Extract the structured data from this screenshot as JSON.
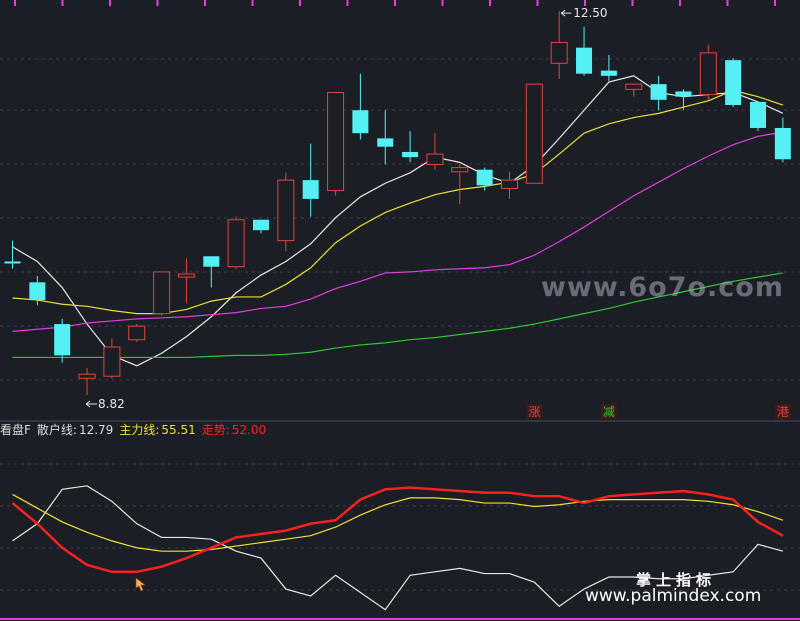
{
  "colors": {
    "bg": "#1c1e26",
    "up": "#e0443c",
    "down": "#54f0f4",
    "ma_white": "#e8e8e8",
    "ma_yellow": "#e8e035",
    "ma_magenta": "#e13ce1",
    "ma_green": "#2ec436",
    "retail": "#e8e8e8",
    "main_force": "#f0e033",
    "trend": "#ff2020",
    "label_up": "#e0443c",
    "label_down": "#31c831",
    "pink_ticks": "#e040e0"
  },
  "legend": {
    "indicator": "看盘F",
    "retail_label": "散户线:",
    "retail_value": "12.79",
    "main_label": "主力线:",
    "main_value": "55.51",
    "trend_label": "走势:",
    "trend_value": "52.00"
  },
  "annotations": {
    "high_label": "12.50",
    "low_label": "8.82"
  },
  "watermarks": {
    "site": "www.6o7o.com",
    "cn": "掌上指标",
    "url": "www.palmindex.com"
  },
  "chart_data": [
    {
      "type": "candlestick",
      "title": "",
      "candles": [
        {
          "o": 10.1,
          "h": 10.3,
          "l": 10.03,
          "c": 10.1,
          "dir": "down"
        },
        {
          "o": 9.9,
          "h": 9.96,
          "l": 9.68,
          "c": 9.73,
          "dir": "down"
        },
        {
          "o": 9.5,
          "h": 9.55,
          "l": 9.13,
          "c": 9.2,
          "dir": "down"
        },
        {
          "o": 8.98,
          "h": 9.08,
          "l": 8.82,
          "c": 9.02,
          "dir": "up"
        },
        {
          "o": 9.0,
          "h": 9.36,
          "l": 8.98,
          "c": 9.28,
          "dir": "up"
        },
        {
          "o": 9.35,
          "h": 9.5,
          "l": 9.33,
          "c": 9.48,
          "dir": "up"
        },
        {
          "o": 9.6,
          "h": 10.0,
          "l": 9.58,
          "c": 10.0,
          "dir": "up"
        },
        {
          "o": 9.95,
          "h": 10.13,
          "l": 9.7,
          "c": 9.98,
          "dir": "up"
        },
        {
          "o": 10.05,
          "h": 10.15,
          "l": 9.85,
          "c": 10.15,
          "dir": "down"
        },
        {
          "o": 10.05,
          "h": 10.53,
          "l": 10.03,
          "c": 10.5,
          "dir": "up"
        },
        {
          "o": 10.5,
          "h": 10.5,
          "l": 10.37,
          "c": 10.4,
          "dir": "down"
        },
        {
          "o": 10.3,
          "h": 10.95,
          "l": 10.2,
          "c": 10.88,
          "dir": "up"
        },
        {
          "o": 10.88,
          "h": 11.23,
          "l": 10.53,
          "c": 10.7,
          "dir": "down"
        },
        {
          "o": 10.78,
          "h": 11.4,
          "l": 10.73,
          "c": 11.72,
          "dir": "up"
        },
        {
          "o": 11.55,
          "h": 11.9,
          "l": 11.27,
          "c": 11.33,
          "dir": "down"
        },
        {
          "o": 11.28,
          "h": 11.55,
          "l": 11.03,
          "c": 11.2,
          "dir": "down"
        },
        {
          "o": 11.15,
          "h": 11.35,
          "l": 11.05,
          "c": 11.1,
          "dir": "down"
        },
        {
          "o": 11.03,
          "h": 11.33,
          "l": 10.98,
          "c": 11.13,
          "dir": "up"
        },
        {
          "o": 10.96,
          "h": 11.04,
          "l": 10.65,
          "c": 11.0,
          "dir": "up"
        },
        {
          "o": 10.98,
          "h": 11.0,
          "l": 10.78,
          "c": 10.83,
          "dir": "down"
        },
        {
          "o": 10.8,
          "h": 10.96,
          "l": 10.7,
          "c": 10.88,
          "dir": "up"
        },
        {
          "o": 10.85,
          "h": 11.8,
          "l": 10.85,
          "c": 11.8,
          "dir": "up"
        },
        {
          "o": 12.0,
          "h": 12.5,
          "l": 11.85,
          "c": 12.2,
          "dir": "up"
        },
        {
          "o": 12.15,
          "h": 12.35,
          "l": 11.88,
          "c": 11.9,
          "dir": "down"
        },
        {
          "o": 11.93,
          "h": 12.08,
          "l": 11.83,
          "c": 11.88,
          "dir": "down"
        },
        {
          "o": 11.75,
          "h": 11.8,
          "l": 11.68,
          "c": 11.8,
          "dir": "up"
        },
        {
          "o": 11.8,
          "h": 11.88,
          "l": 11.55,
          "c": 11.65,
          "dir": "down"
        },
        {
          "o": 11.73,
          "h": 11.75,
          "l": 11.55,
          "c": 11.68,
          "dir": "down"
        },
        {
          "o": 11.7,
          "h": 12.18,
          "l": 11.65,
          "c": 12.1,
          "dir": "up"
        },
        {
          "o": 12.03,
          "h": 12.05,
          "l": 11.58,
          "c": 11.6,
          "dir": "down"
        },
        {
          "o": 11.63,
          "h": 11.63,
          "l": 11.35,
          "c": 11.38,
          "dir": "down"
        },
        {
          "o": 11.38,
          "h": 11.48,
          "l": 11.05,
          "c": 11.08,
          "dir": "down"
        }
      ],
      "moving_averages": [
        {
          "color_key": "ma_white",
          "values": [
            10.24,
            10.1,
            9.85,
            9.5,
            9.2,
            9.1,
            9.22,
            9.38,
            9.57,
            9.8,
            9.97,
            10.1,
            10.27,
            10.52,
            10.72,
            10.85,
            10.95,
            11.1,
            11.05,
            10.93,
            10.85,
            11.02,
            11.28,
            11.55,
            11.82,
            11.88,
            11.72,
            11.68,
            11.7,
            11.72,
            11.63,
            11.52
          ]
        },
        {
          "color_key": "ma_yellow",
          "values": [
            9.75,
            9.73,
            9.69,
            9.67,
            9.63,
            9.6,
            9.6,
            9.64,
            9.72,
            9.76,
            9.76,
            9.88,
            10.04,
            10.28,
            10.44,
            10.57,
            10.66,
            10.74,
            10.79,
            10.82,
            10.86,
            10.94,
            11.13,
            11.33,
            11.42,
            11.48,
            11.52,
            11.58,
            11.64,
            11.74,
            11.68,
            11.6
          ]
        },
        {
          "color_key": "ma_magenta",
          "values": [
            9.43,
            9.45,
            9.47,
            9.51,
            9.53,
            9.55,
            9.56,
            9.57,
            9.59,
            9.61,
            9.65,
            9.67,
            9.74,
            9.84,
            9.91,
            9.99,
            10.0,
            10.02,
            10.03,
            10.04,
            10.07,
            10.16,
            10.29,
            10.43,
            10.58,
            10.73,
            10.86,
            10.99,
            11.11,
            11.22,
            11.3,
            11.34
          ]
        },
        {
          "color_key": "ma_green",
          "values": [
            9.18,
            9.18,
            9.18,
            9.18,
            9.18,
            9.18,
            9.18,
            9.18,
            9.19,
            9.2,
            9.2,
            9.21,
            9.23,
            9.27,
            9.3,
            9.32,
            9.35,
            9.37,
            9.4,
            9.43,
            9.46,
            9.5,
            9.55,
            9.6,
            9.65,
            9.71,
            9.76,
            9.81,
            9.86,
            9.91,
            9.95,
            9.99
          ]
        }
      ],
      "signals": [
        {
          "index": 21,
          "text": "涨",
          "color_key": "label_up"
        },
        {
          "index": 24,
          "text": "减",
          "color_key": "label_down"
        },
        {
          "index": 31,
          "text": "港",
          "color_key": "label_up"
        }
      ]
    },
    {
      "type": "line",
      "title": "",
      "ylim": [
        0,
        100
      ],
      "series": [
        {
          "name": "散户线",
          "color_key": "retail",
          "values": [
            46,
            56,
            76,
            78,
            69,
            56,
            48,
            48,
            47,
            40,
            36,
            18,
            14,
            26,
            16,
            6,
            26,
            28,
            30,
            27,
            27,
            22,
            8,
            18,
            25,
            25,
            24,
            24,
            26,
            28,
            44,
            40
          ]
        },
        {
          "name": "主力线",
          "color_key": "main_force",
          "values": [
            73,
            65,
            57,
            51,
            46,
            42,
            40,
            40,
            41,
            43,
            45,
            47,
            49,
            54,
            61,
            67,
            71,
            71,
            70,
            68,
            68,
            66,
            67,
            69,
            70,
            70,
            70,
            70,
            69,
            67,
            63,
            58
          ]
        },
        {
          "name": "走势",
          "color_key": "trend",
          "values": [
            68,
            56,
            42,
            32,
            28,
            28,
            31,
            36,
            42,
            48,
            50,
            52,
            56,
            58,
            70,
            76,
            77,
            76,
            75,
            74,
            74,
            72,
            72,
            68,
            72,
            73,
            74,
            75,
            73,
            70,
            57,
            49
          ]
        }
      ]
    }
  ]
}
